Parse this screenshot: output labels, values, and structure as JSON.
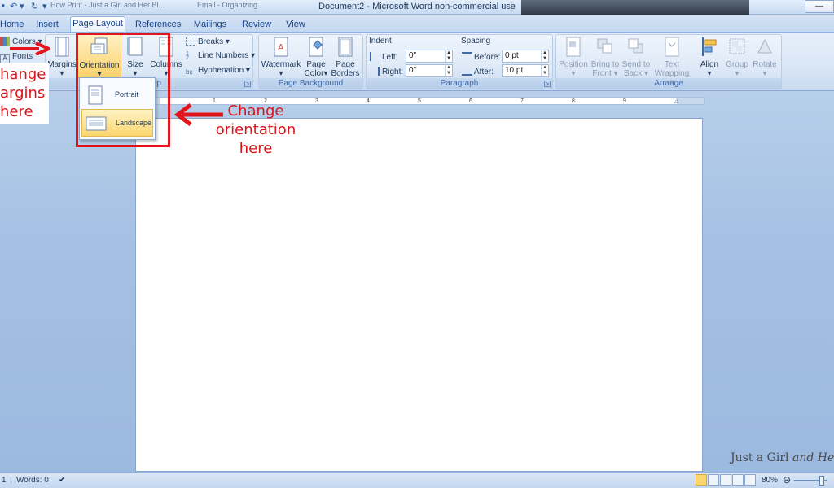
{
  "window": {
    "title": "Document2 - Microsoft Word non-commercial use",
    "task_fragment_1": "How Print - Just a Girl and Her Bl...",
    "task_fragment_2": "Email - Organizing"
  },
  "tabs": [
    {
      "label": "Home",
      "active": false
    },
    {
      "label": "Insert",
      "active": false
    },
    {
      "label": "Page Layout",
      "active": true
    },
    {
      "label": "References",
      "active": false
    },
    {
      "label": "Mailings",
      "active": false
    },
    {
      "label": "Review",
      "active": false
    },
    {
      "label": "View",
      "active": false
    }
  ],
  "ribbon": {
    "themes": {
      "colors": "Colors",
      "fonts": "Fonts"
    },
    "page_setup": {
      "margins": "Margins",
      "orientation": "Orientation",
      "size": "Size",
      "columns": "Columns",
      "breaks": "Breaks",
      "line_numbers": "Line Numbers",
      "hyphenation": "Hyphenation",
      "group_label": "Page Setup",
      "group_label_visible": "up"
    },
    "page_background": {
      "watermark": "Watermark",
      "page_color_1": "Page",
      "page_color_2": "Color",
      "page_borders_1": "Page",
      "page_borders_2": "Borders",
      "group_label": "Page Background"
    },
    "paragraph": {
      "indent_label": "Indent",
      "spacing_label": "Spacing",
      "left_label": "Left:",
      "left_value": "0\"",
      "right_label": "Right:",
      "right_value": "0\"",
      "before_label": "Before:",
      "before_value": "0 pt",
      "after_label": "After:",
      "after_value": "10 pt",
      "group_label": "Paragraph"
    },
    "arrange": {
      "position": "Position",
      "bring_1": "Bring to",
      "bring_2": "Front",
      "send_1": "Send to",
      "send_2": "Back",
      "wrap_1": "Text",
      "wrap_2": "Wrapping",
      "align": "Align",
      "group": "Group",
      "rotate": "Rotate",
      "group_label": "Arrange"
    }
  },
  "orientation_menu": {
    "portrait": "Portrait",
    "landscape": "Landscape",
    "highlighted": "landscape"
  },
  "ruler": {
    "marks": [
      "1",
      "2",
      "3",
      "4",
      "5",
      "6",
      "7",
      "8",
      "9"
    ]
  },
  "annotations": {
    "margins_1": "hange",
    "margins_2": "argins",
    "margins_3": "here",
    "orientation_1": "Change",
    "orientation_2": "orientation",
    "orientation_3": "here",
    "color": "#e3141b"
  },
  "statusbar": {
    "page": "1",
    "words": "Words: 0",
    "zoom": "80%"
  },
  "watermark": {
    "text_a": "Just a Girl ",
    "text_b": "and Her"
  },
  "colors": {
    "ribbon": "#dbe6f5",
    "workspace": "#a4c0e3",
    "highlight": "#fbd66e"
  }
}
